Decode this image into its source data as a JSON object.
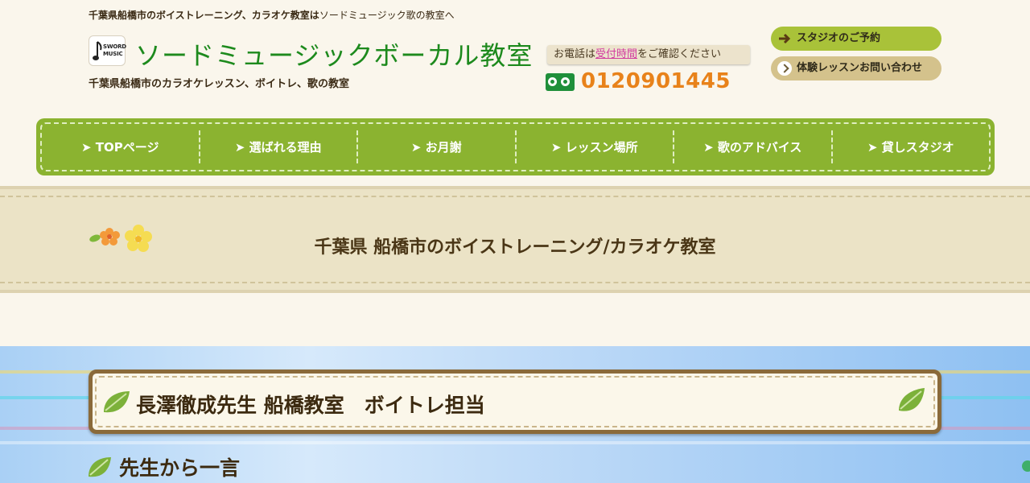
{
  "header": {
    "tagline_bold": "千葉県船橋市のボイストレーニング、カラオケ教室は",
    "tagline_normal": "ソードミュージック歌の教室へ",
    "logo_text_1": "SWORD",
    "logo_text_2": "MUSIC",
    "site_title": "ソードミュージックボーカル教室",
    "site_subtitle": "千葉県船橋市のカラオケレッスン、ボイトレ、歌の教室",
    "tel_note_prefix": "お電話は",
    "tel_note_link": "受付時間",
    "tel_note_suffix": "をご確認ください",
    "phone": "0120901445",
    "studio_button": "スタジオのご予約",
    "trial_button": "体験レッスンお問い合わせ"
  },
  "nav": {
    "items": [
      {
        "label": "➤ TOPページ"
      },
      {
        "label": "➤ 選ばれる理由"
      },
      {
        "label": "➤ お月謝"
      },
      {
        "label": "➤ レッスン場所"
      },
      {
        "label": "➤ 歌のアドバイス"
      },
      {
        "label": "➤ 貸しスタジオ"
      }
    ]
  },
  "page": {
    "title": "千葉県 船橋市のボイストレーニング/カラオケ教室"
  },
  "hero": {
    "teacher_title": "長澤徹成先生 船橋教室　ボイトレ担当",
    "section_title": "先生から一言"
  },
  "colors": {
    "title_green": "#1d8a1d",
    "nav_green": "#8bb330",
    "phone_orange": "#e8821a",
    "tel_green": "#1f8f3a"
  }
}
